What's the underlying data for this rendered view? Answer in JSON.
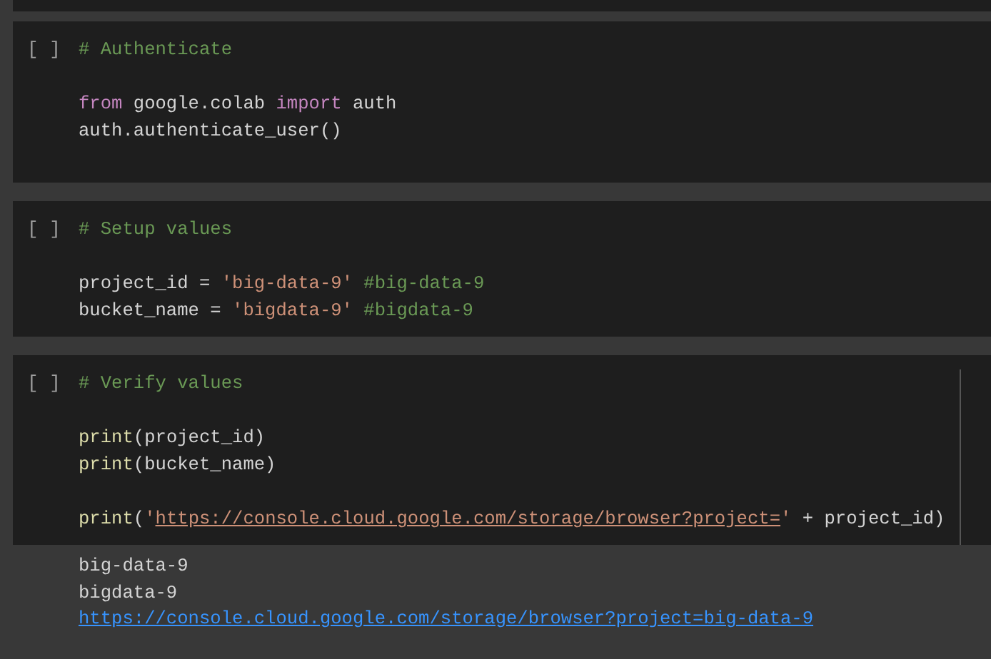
{
  "cells": [
    {
      "prompt": "[ ]",
      "blocks": [
        [
          [
            {
              "kind": "comment",
              "text": "# Authenticate"
            }
          ]
        ],
        [
          [
            {
              "kind": "keyword",
              "text": "from"
            },
            {
              "kind": "plain",
              "text": " google.colab "
            },
            {
              "kind": "keyword",
              "text": "import"
            },
            {
              "kind": "plain",
              "text": " auth"
            }
          ],
          [
            {
              "kind": "plain",
              "text": "auth.authenticate_user()"
            }
          ]
        ]
      ]
    },
    {
      "prompt": "[ ]",
      "blocks": [
        [
          [
            {
              "kind": "comment",
              "text": "# Setup values"
            }
          ]
        ],
        [
          [
            {
              "kind": "plain",
              "text": "project_id = "
            },
            {
              "kind": "string",
              "text": "'big-data-9'"
            },
            {
              "kind": "comment",
              "text": " #big-data-9"
            }
          ],
          [
            {
              "kind": "plain",
              "text": "bucket_name = "
            },
            {
              "kind": "string",
              "text": "'bigdata-9'"
            },
            {
              "kind": "comment",
              "text": " #bigdata-9"
            }
          ]
        ]
      ]
    },
    {
      "prompt": "[ ]",
      "blocks": [
        [
          [
            {
              "kind": "comment",
              "text": "# Verify values"
            }
          ]
        ],
        [
          [
            {
              "kind": "function",
              "text": "print"
            },
            {
              "kind": "plain",
              "text": "(project_id)"
            }
          ],
          [
            {
              "kind": "function",
              "text": "print"
            },
            {
              "kind": "plain",
              "text": "(bucket_name)"
            }
          ]
        ],
        [
          [
            {
              "kind": "function",
              "text": "print"
            },
            {
              "kind": "plain",
              "text": "("
            },
            {
              "kind": "string",
              "text": "'"
            },
            {
              "kind": "url_string",
              "text": "https://console.cloud.google.com/storage/browser?project="
            },
            {
              "kind": "string",
              "text": "'"
            },
            {
              "kind": "plain",
              "text": " + project_id)"
            }
          ]
        ]
      ],
      "output": [
        {
          "kind": "text",
          "text": "big-data-9"
        },
        {
          "kind": "text",
          "text": "bigdata-9"
        },
        {
          "kind": "link",
          "text": "https://console.cloud.google.com/storage/browser?project=big-data-9"
        }
      ]
    }
  ]
}
